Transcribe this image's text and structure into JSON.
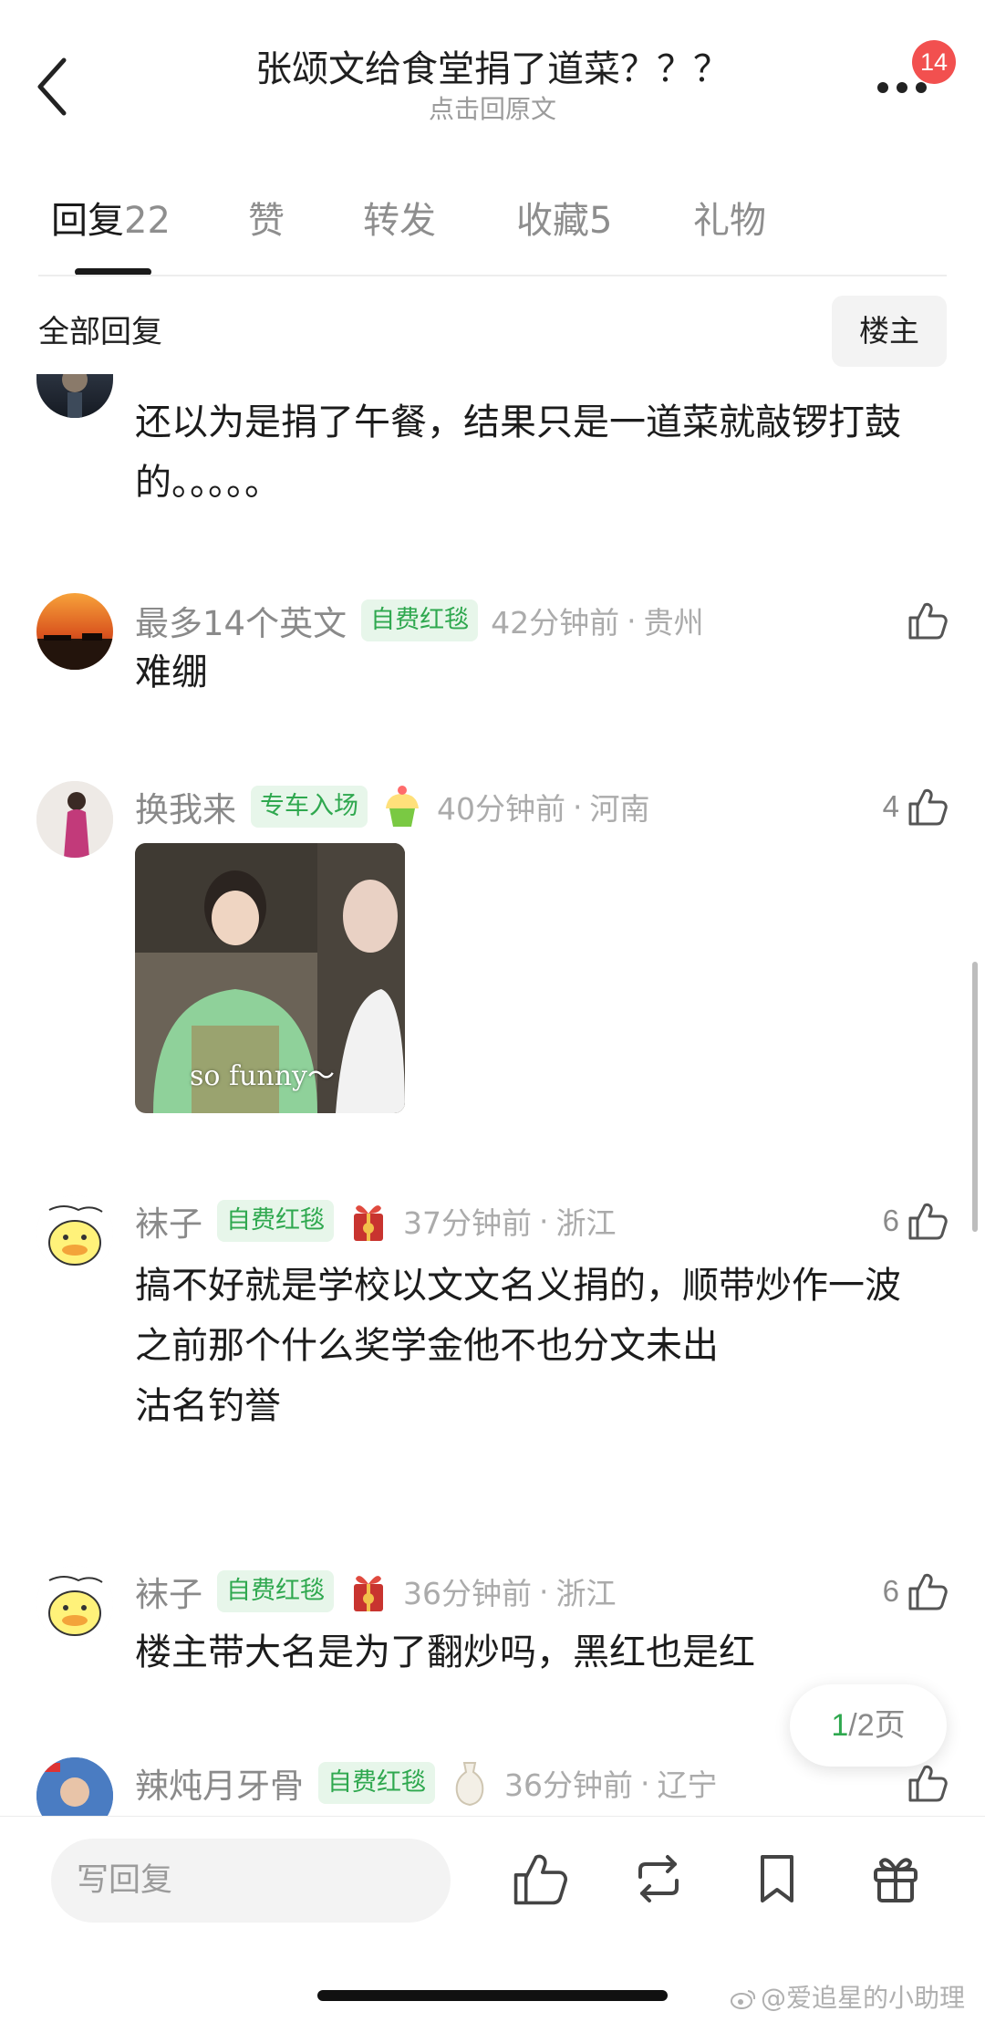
{
  "header": {
    "title": "张颂文给食堂捐了道菜？？？",
    "subtitle": "点击回原文",
    "notification_count": "14"
  },
  "tabs": [
    {
      "label": "回复",
      "count": "22"
    },
    {
      "label": "赞",
      "count": ""
    },
    {
      "label": "转发",
      "count": ""
    },
    {
      "label": "收藏",
      "count": "5"
    },
    {
      "label": "礼物",
      "count": ""
    }
  ],
  "filter": {
    "label": "全部回复",
    "op_button": "楼主"
  },
  "comments": [
    {
      "text": "还以为是捐了午餐，结果只是一道菜就敲锣打鼓的。。。。。"
    },
    {
      "author": "最多14个英文",
      "tag": "自费红毯",
      "time": "42分钟前",
      "region": "贵州",
      "likes": "",
      "text": "难绷"
    },
    {
      "author": "换我来",
      "tag": "专车入场",
      "deco": "cupcake-icon",
      "time": "40分钟前",
      "region": "河南",
      "likes": "4",
      "image_caption": "so funny～"
    },
    {
      "author": "袜子",
      "tag": "自费红毯",
      "deco": "gift-box-icon",
      "time": "37分钟前",
      "region": "浙江",
      "likes": "6",
      "text": "搞不好就是学校以文文名义捐的，顺带炒作一波\n之前那个什么奖学金他不也分文未出\n沽名钓誉"
    },
    {
      "author": "袜子",
      "tag": "自费红毯",
      "deco": "gift-box-icon",
      "time": "36分钟前",
      "region": "浙江",
      "likes": "6",
      "text": "楼主带大名是为了翻炒吗，黑红也是红"
    },
    {
      "author": "辣炖月牙骨",
      "tag": "自费红毯",
      "deco": "vase-icon",
      "time": "36分钟前",
      "region": "辽宁",
      "likes": ""
    }
  ],
  "pagination": {
    "current": "1",
    "total": "/2",
    "suffix": "页"
  },
  "bottom_bar": {
    "reply_placeholder": "写回复"
  },
  "watermark": "@爱追星的小助理",
  "colors": {
    "accent_green": "#2fa84f",
    "badge_red": "#f2504f",
    "text_primary": "#1c1c1c",
    "text_secondary": "#8a8a8a"
  }
}
